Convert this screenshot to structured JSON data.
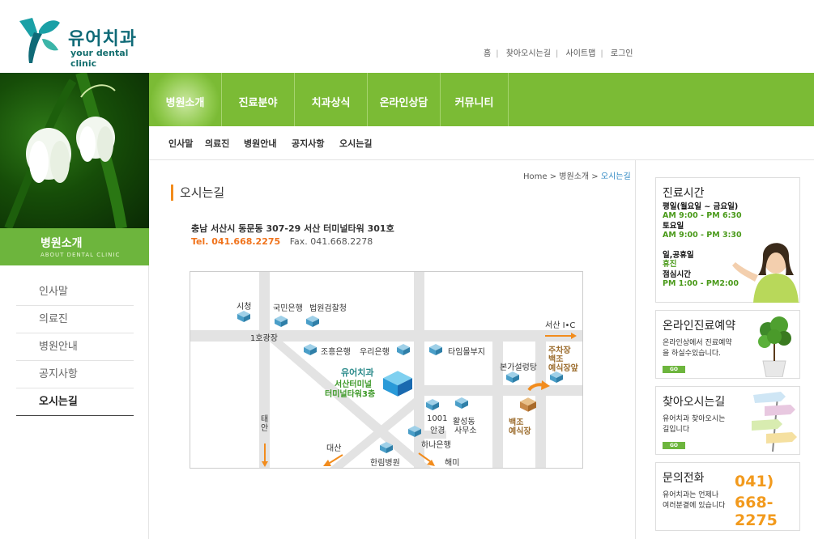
{
  "logo": {
    "korean": "유어치과",
    "english": "your dental clinic"
  },
  "top_links": [
    "홈",
    "찾아오시는길",
    "사이트맵",
    "로그인"
  ],
  "side": {
    "title": "병원소개",
    "subtitle": "ABOUT DENTAL CLINIC",
    "menu": [
      "인사말",
      "의료진",
      "병원안내",
      "공지사항",
      "오시는길"
    ],
    "active": "오시는길"
  },
  "gnb": [
    "병원소개",
    "진료분야",
    "치과상식",
    "온라인상담",
    "커뮤니티"
  ],
  "subnav": [
    "인사말",
    "의료진",
    "병원안내",
    "공지사항",
    "오시는길"
  ],
  "breadcrumb": {
    "home": "Home",
    "sep": ">",
    "section": "병원소개",
    "current": "오시는길"
  },
  "page_title": "오시는길",
  "address": "충남 서산시 동문동 307-29  서산 터미널타워 301호",
  "tel": "Tel. 041.668.2275",
  "fax": "Fax. 041.668.2278",
  "map": {
    "labels": {
      "city_hall": "시청",
      "kookmin": "국민은행",
      "prosecutor": "법원검찰청",
      "plaza": "1호광장",
      "seosan_ic": "서산 I•C",
      "chohung": "조흥은행",
      "woori": "우리은행",
      "timmall": "타임몰부지",
      "clinic": "유어치과",
      "clinic_addr1": "서산터미널",
      "clinic_addr2": "터미널타워3층",
      "bongasul": "본가설렁탕",
      "parking1": "주차장",
      "parking2": "백조",
      "parking3": "예식장앞",
      "taean1": "태",
      "taean2": "안",
      "anbank1": "1001",
      "anbank2": "안경",
      "hwalseong1": "활성동",
      "hwalseong2": "사무소",
      "baekjo1": "백조",
      "baekjo2": "예식장",
      "hana": "하나은행",
      "daesan": "대산",
      "hallim": "한림병원",
      "haemi": "해미"
    }
  },
  "right": {
    "hours": {
      "title": "진료시간",
      "rows": [
        {
          "k": "평일(월요일 ~ 금요일)",
          "v": "AM 9:00 - PM 6:30"
        },
        {
          "k": "토요일",
          "v": "AM 9:00 - PM 3:30"
        },
        {
          "k": "일,공휴일",
          "v": "휴진"
        },
        {
          "k": "점심시간",
          "v": "PM 1:00 - PM2:00"
        }
      ]
    },
    "reserve": {
      "title": "온라인진료예약",
      "desc1": "온라인상에서 진료예약",
      "desc2": "을 하실수있습니다.",
      "go": "GO"
    },
    "directions": {
      "title": "찾아오시는길",
      "desc1": "유어치과 찾아오시는",
      "desc2": "길입니다",
      "go": "GO"
    },
    "phone": {
      "title": "문의전화",
      "desc1": "유어치과는 언제나",
      "desc2": "여러분곁에 있습니다",
      "num1": "041)",
      "num2": "668-2275"
    }
  },
  "colors": {
    "green": "#7bbb35",
    "orange": "#f28c1d",
    "blue": "#2b86c2"
  }
}
